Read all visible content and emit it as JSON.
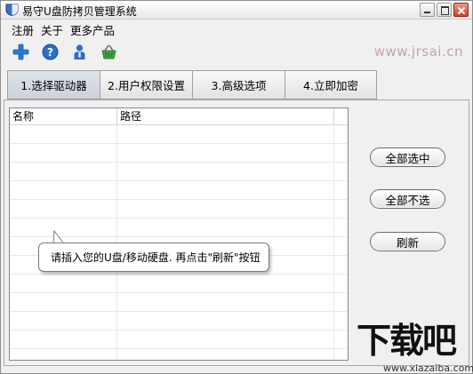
{
  "window": {
    "title": "易守U盘防拷贝管理系统"
  },
  "menu": {
    "items": [
      "注册",
      "关于",
      "更多产品"
    ]
  },
  "toolbar": {
    "icons": [
      "plus-icon",
      "help-icon",
      "user-icon",
      "basket-icon"
    ]
  },
  "watermark_url": "www.jrsai.cn",
  "tabs": [
    {
      "label": "1.选择驱动器",
      "active": true
    },
    {
      "label": "2.用户权限设置",
      "active": false
    },
    {
      "label": "3.高级选项",
      "active": false
    },
    {
      "label": "4.立即加密",
      "active": false
    }
  ],
  "grid": {
    "columns": [
      "名称",
      "路径"
    ],
    "rows": []
  },
  "buttons": {
    "select_all": "全部选中",
    "select_none": "全部不选",
    "refresh": "刷新"
  },
  "tooltip": {
    "text": "请插入您的U盘/移动硬盘. 再点击\"刷新\"按钮"
  },
  "brand": {
    "logo_text": "下载吧",
    "url": "www.xiazaiba.com"
  },
  "colors": {
    "watermark": "#c9a2ab",
    "plus_icon": "#2a7ad6",
    "help_icon": "#2a6fc8",
    "basket_icon": "#3aa33a"
  }
}
